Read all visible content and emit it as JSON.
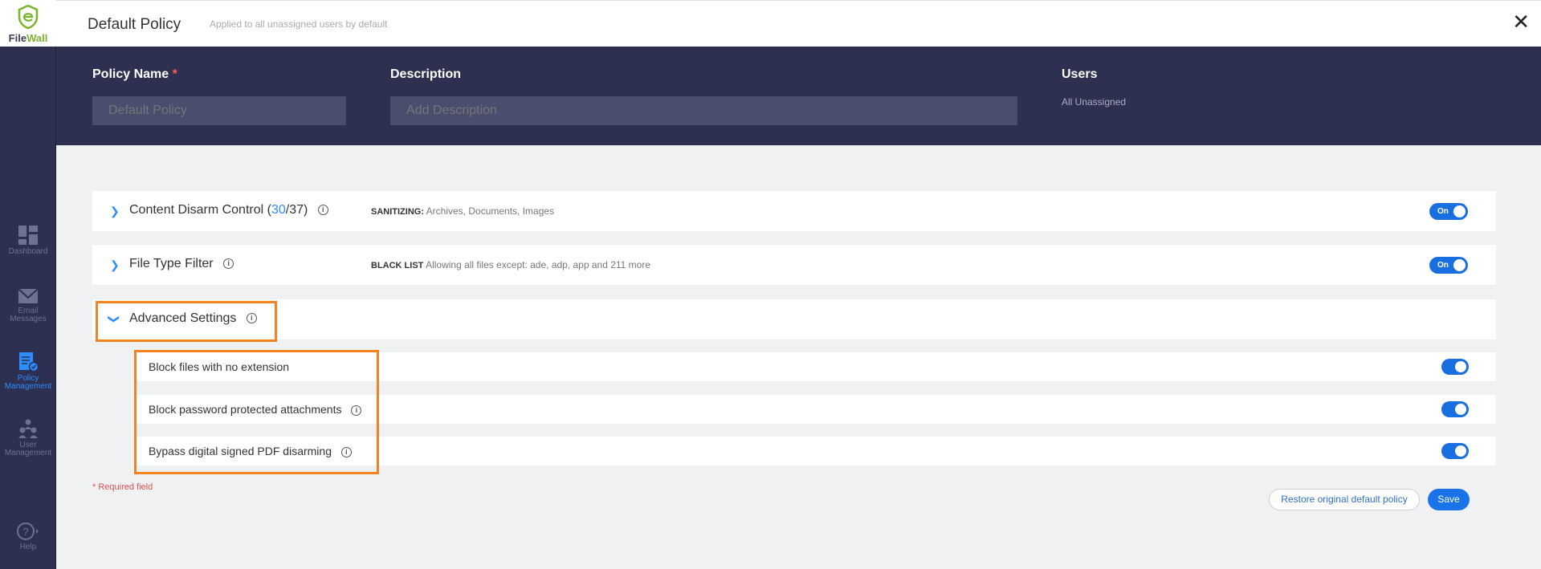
{
  "app": {
    "logo_prefix": "File",
    "logo_suffix": "Wall"
  },
  "sidebar": {
    "items": [
      {
        "label": "Dashboard",
        "icon": "dashboard-icon",
        "active": false
      },
      {
        "label": "Email Messages",
        "icon": "email-icon",
        "active": false
      },
      {
        "label": "Policy Management",
        "icon": "policy-icon",
        "active": true
      },
      {
        "label": "User Management",
        "icon": "users-icon",
        "active": false
      },
      {
        "label": "Help",
        "icon": "help-icon",
        "active": false
      }
    ]
  },
  "header": {
    "title": "Default Policy",
    "subtitle": "Applied to all unassigned users by default",
    "close_icon": "close-icon"
  },
  "form": {
    "policy_name_label": "Policy Name",
    "required_mark": "*",
    "policy_name_placeholder": "Default Policy",
    "description_label": "Description",
    "description_placeholder": "Add Description",
    "users_label": "Users",
    "users_value": "All Unassigned"
  },
  "sections": {
    "cdc": {
      "title": "Content Disarm Control (",
      "count_active": "30",
      "count_total": "/37)",
      "desc_label": "SANITIZING:",
      "desc_text": "Archives, Documents, Images",
      "toggle_label": "On"
    },
    "filetype": {
      "title": "File Type Filter",
      "desc_label": "BLACK LIST",
      "desc_text": "Allowing all files except: ade, adp, app and 211 more",
      "toggle_label": "On"
    },
    "advanced": {
      "title": "Advanced Settings",
      "items": [
        {
          "label": "Block files with no extension",
          "enabled": true
        },
        {
          "label": "Block password protected attachments",
          "enabled": true
        },
        {
          "label": "Bypass digital signed PDF disarming",
          "enabled": true
        }
      ]
    }
  },
  "footer": {
    "required_note": "* Required field",
    "restore_label": "Restore original default policy",
    "save_label": "Save"
  },
  "colors": {
    "sidebar_bg": "#2d3050",
    "accent": "#1a73e8",
    "highlight": "#f58220",
    "logo_green": "#7ab32e"
  }
}
